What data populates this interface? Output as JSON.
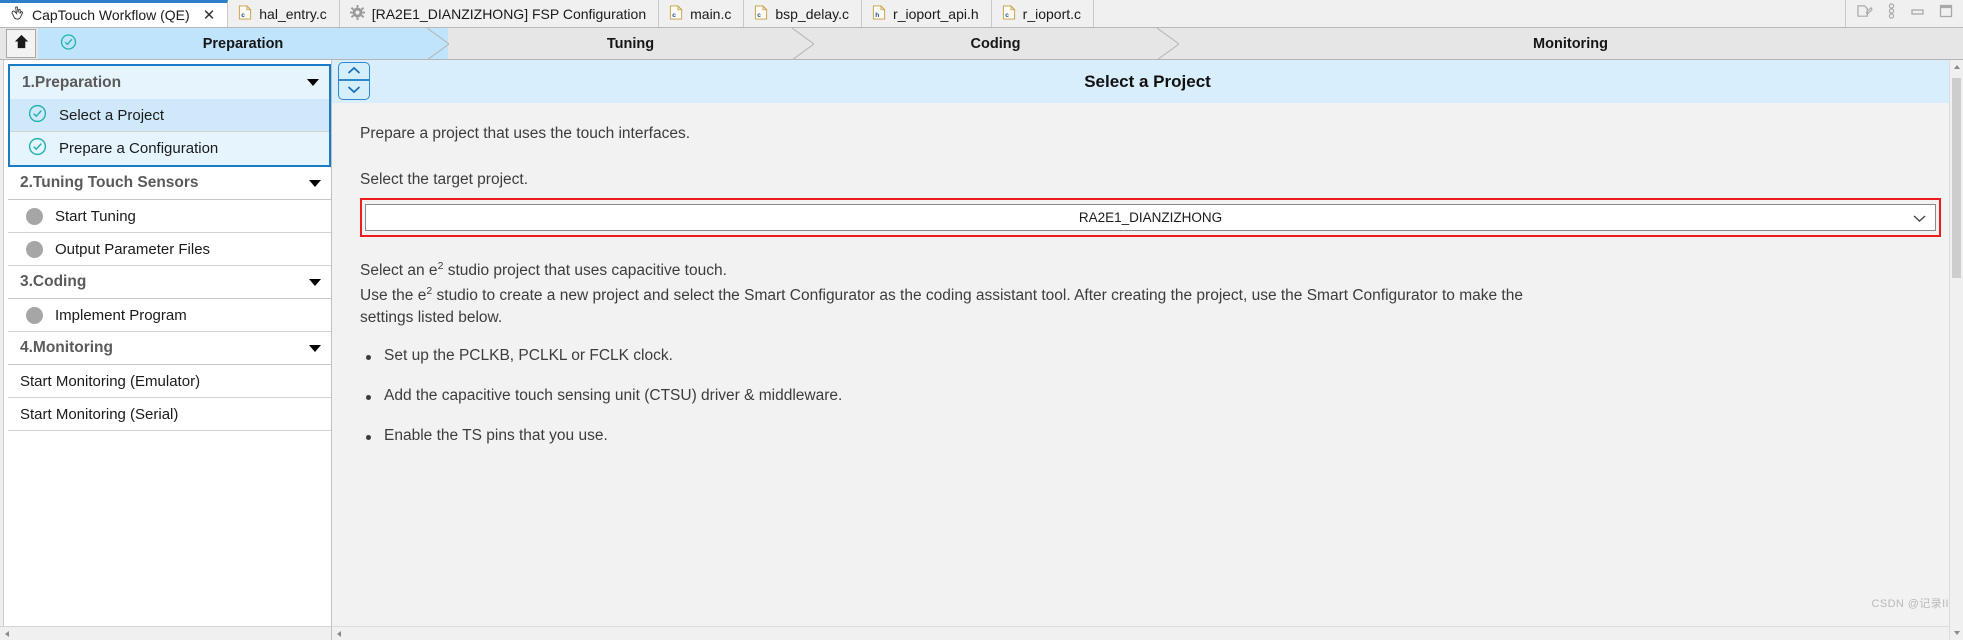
{
  "window": {
    "tools": [
      {
        "name": "restore-view-icon",
        "glyph": "restore"
      },
      {
        "name": "view-menu-icon",
        "glyph": "menu"
      },
      {
        "name": "minimize-icon",
        "glyph": "minimize"
      },
      {
        "name": "maximize-icon",
        "glyph": "maximize"
      }
    ]
  },
  "tabs": [
    {
      "label": "CapTouch Workflow (QE)",
      "icon": "captouch-icon",
      "active": true,
      "closable": true,
      "close_label": "✕"
    },
    {
      "label": "hal_entry.c",
      "icon": "c-file-icon",
      "active": false,
      "closable": false
    },
    {
      "label": "[RA2E1_DIANZIZHONG] FSP Configuration",
      "icon": "gear-icon",
      "active": false,
      "closable": false
    },
    {
      "label": "main.c",
      "icon": "c-file-icon",
      "active": false,
      "closable": false
    },
    {
      "label": "bsp_delay.c",
      "icon": "c-file-icon",
      "active": false,
      "closable": false
    },
    {
      "label": "r_ioport_api.h",
      "icon": "h-file-icon",
      "active": false,
      "closable": false
    },
    {
      "label": "r_ioport.c",
      "icon": "c-file-icon",
      "active": false,
      "closable": false
    }
  ],
  "workflow": {
    "home_button": "home-icon",
    "steps": [
      {
        "label": "Preparation",
        "active": true,
        "checked": true
      },
      {
        "label": "Tuning",
        "active": false,
        "checked": false
      },
      {
        "label": "Coding",
        "active": false,
        "checked": false
      },
      {
        "label": "Monitoring",
        "active": false,
        "checked": false
      }
    ]
  },
  "sidebar": {
    "sections": [
      {
        "header": "1.Preparation",
        "boxed": true,
        "items": [
          {
            "label": "Select a Project",
            "state": "done",
            "highlighted": true
          },
          {
            "label": "Prepare a Configuration",
            "state": "done",
            "highlighted": false
          }
        ]
      },
      {
        "header": "2.Tuning Touch Sensors",
        "boxed": false,
        "items": [
          {
            "label": "Start Tuning",
            "state": "pending",
            "highlighted": false
          },
          {
            "label": "Output Parameter Files",
            "state": "pending",
            "highlighted": false
          }
        ]
      },
      {
        "header": "3.Coding",
        "boxed": false,
        "items": [
          {
            "label": "Implement Program",
            "state": "pending",
            "highlighted": false
          }
        ]
      },
      {
        "header": "4.Monitoring",
        "boxed": false,
        "items": [
          {
            "label": "Start Monitoring (Emulator)",
            "state": "none",
            "highlighted": false
          },
          {
            "label": "Start Monitoring (Serial)",
            "state": "none",
            "highlighted": false
          }
        ]
      }
    ]
  },
  "main": {
    "title": "Select a Project",
    "intro": "Prepare a project that uses the touch interfaces.",
    "select_label": "Select the target project.",
    "project_combo": {
      "value": "RA2E1_DIANZIZHONG",
      "placeholder": "RA2E1_DIANZIZHONG"
    },
    "desc_line1_a": "Select an e",
    "desc_line1_sup": "2",
    "desc_line1_b": " studio project that uses capacitive touch.",
    "desc_line2_a": "Use the e",
    "desc_line2_sup": "2",
    "desc_line2_b": " studio to create a new project and select the Smart Configurator as the coding assistant tool. After creating the project, use the Smart Configurator to make the settings listed below.",
    "bullets": [
      "Set up the PCLKB, PCLKL or FCLK clock.",
      "Add the capacitive touch sensing unit (CTSU) driver & middleware.",
      "Enable the TS pins that you use."
    ]
  },
  "watermark": "CSDN @记录II",
  "colors": {
    "accent_blue": "#1a7cc4",
    "active_step": "#bfe4fb",
    "header_band": "#d9eefc",
    "highlight_row": "#cfe9fb",
    "check_teal": "#22b2b2",
    "error_red": "#ee1c1c",
    "pending_grey": "#a6a6a6"
  }
}
